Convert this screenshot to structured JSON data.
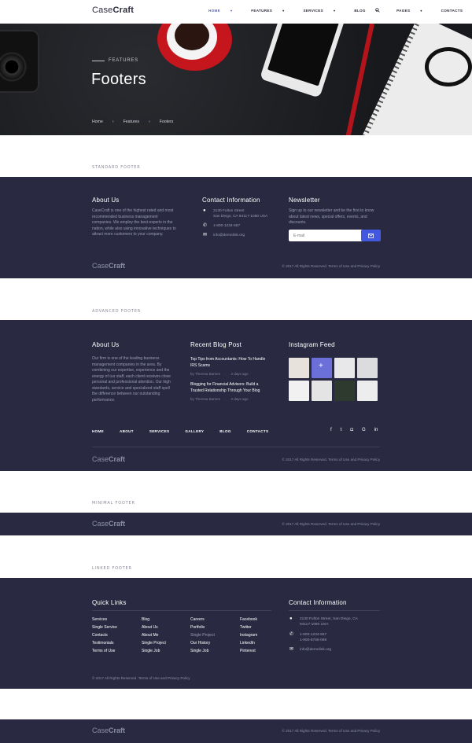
{
  "header": {
    "logo_light": "Case",
    "logo_bold": "Craft",
    "nav": [
      {
        "label": "HOME",
        "caret": "▾"
      },
      {
        "label": "FEATURES",
        "caret": "▾"
      },
      {
        "label": "SERVICES",
        "caret": "▾"
      },
      {
        "label": "BLOG",
        "caret": "▾"
      },
      {
        "label": "PAGES",
        "caret": "▾"
      },
      {
        "label": "CONTACTS",
        "caret": ""
      }
    ],
    "search_icon": "search-icon"
  },
  "hero": {
    "eyebrow": "FEATURES",
    "title": "Footers",
    "breadcrumb": [
      "Home",
      "Features",
      "Footers"
    ],
    "separator": "›"
  },
  "sections": {
    "standard": "STANDARD FOOTER",
    "advanced": "ADVANCED FOOTER",
    "minimal": "MINIMAL FOOTER",
    "linked": "LINKED FOOTER"
  },
  "standard_footer": {
    "about_title": "About Us",
    "about_text": "CaseCraft is one of the highest rated and most recommended business management companies. We employ the best experts in the nation, while also using innovative techniques to attract more customers to your company.",
    "contact_title": "Contact Information",
    "address": "2130 Fulton Street\nSan Diego, CA 94117-1080 USA",
    "address_line1": "2130 Fulton Street",
    "address_line2": "San Diego, CA 94117-1080 USA",
    "phone": "1-800-1234-567",
    "email": "info@demolink.org",
    "newsletter_title": "Newsletter",
    "newsletter_text": "Sign up to our newsletter and be the first to know about latest news, special offers, events, and discounts.",
    "email_placeholder": "E-mail",
    "logo_light": "Case",
    "logo_bold": "Craft",
    "copyright": "© 2017 All Rights Reserved. Terms of Use and Privacy Policy"
  },
  "advanced_footer": {
    "about_title": "About Us",
    "about_text": "Our firm is one of the leading business management companies in the area. By combining our expertise, experience and the energy of our staff, each client receives close personal and professional attention. Our high standards, service and specialized staff spell the difference between our outstanding performance.",
    "blog_title": "Recent Blog Post",
    "posts": [
      {
        "title": "Top Tips from Accountants: How To Handle IRS Scams",
        "author": "by Theresa Barnes",
        "time": "2 days ago"
      },
      {
        "title": "Blogging for Financial Advisors: Build a Trusted Relationship Through Your Blog",
        "author": "by Theresa Barnes",
        "time": "2 days ago"
      }
    ],
    "instagram_title": "Instagram Feed",
    "instagram_colors": [
      "#e7e3dc",
      "#6b70d9",
      "#e8e8ea",
      "#dcdcde",
      "#f1f1f1",
      "#e4e4e4",
      "#2f3a2f",
      "#ededed"
    ],
    "nav": [
      "HOME",
      "ABOUT",
      "SERVICES",
      "GALLERY",
      "BLOG",
      "CONTACTS"
    ],
    "social": [
      "f",
      "t",
      "◘",
      "G",
      "in"
    ],
    "logo_light": "Case",
    "logo_bold": "Craft",
    "copyright": "© 2017 All Rights Reserved. Terms of Use and Privacy Policy"
  },
  "minimal_footer": {
    "logo_light": "Case",
    "logo_bold": "Craft",
    "copyright": "© 2017 All Rights Reserved. Terms of Use and Privacy Policy"
  },
  "linked_footer": {
    "links_title": "Quick Links",
    "columns": [
      [
        "Services",
        "Single Service",
        "Contacts",
        "Testimonials",
        "Terms of Use"
      ],
      [
        "Blog",
        "About Us",
        "About Me",
        "Single Project",
        "Single Job"
      ],
      [
        "Careers",
        "Portfolio",
        "Single Project",
        "Our History",
        "Single Job"
      ],
      [
        "Facebook",
        "Twitter",
        "Instagram",
        "LinkedIn",
        "Pinterest"
      ]
    ],
    "contact_title": "Contact Information",
    "address_line1": "2130 Fulton Street, San Diego, CA",
    "address_line2": "94117-1080 USA",
    "phone1": "1-800-1234-567",
    "phone2": "1-800-8765-098",
    "email": "info@demolink.org",
    "copyright": "© 2017 All Rights Reserved. Terms of Use and Privacy Policy"
  },
  "bottom_footer": {
    "logo_light": "Case",
    "logo_bold": "Craft",
    "copyright": "© 2017 All Rights Reserved. Terms of Use and Privacy Policy"
  },
  "colors": {
    "accent": "#4c5fd7",
    "footer_bg": "#292a41",
    "button": "#4358e0"
  }
}
